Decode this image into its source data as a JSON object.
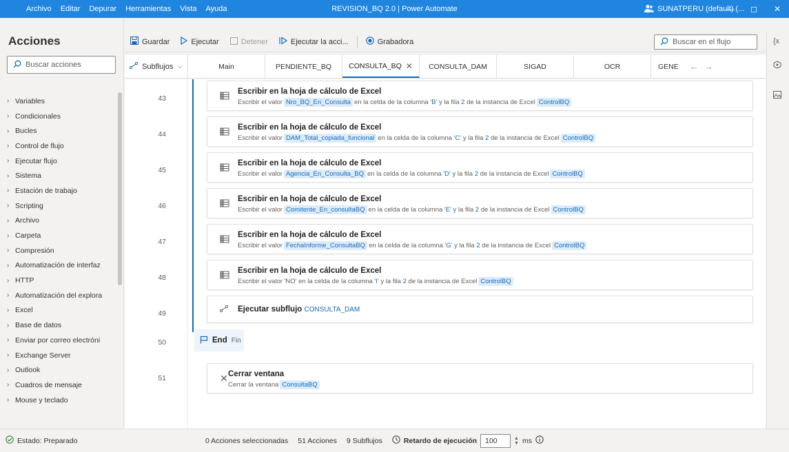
{
  "titlebar": {
    "menu": [
      "Archivo",
      "Editar",
      "Depurar",
      "Herramientas",
      "Vista",
      "Ayuda"
    ],
    "title": "REVISION_BQ 2.0 | Power Automate",
    "user": "SUNATPERU (default) (...",
    "minimize": "—",
    "maximize": "◻",
    "close": "✕",
    "color": "#1f85de"
  },
  "left_panel": {
    "title": "Acciones",
    "search_placeholder": "Buscar acciones",
    "items": [
      "Variables",
      "Condicionales",
      "Bucles",
      "Control de flujo",
      "Ejecutar flujo",
      "Sistema",
      "Estación de trabajo",
      "Scripting",
      "Archivo",
      "Carpeta",
      "Compresión",
      "Automatización de interfaz",
      "HTTP",
      "Automatización del explora",
      "Excel",
      "Base de datos",
      "Enviar por correo electróni",
      "Exchange Server",
      "Outlook",
      "Cuadros de mensaje",
      "Mouse y teclado"
    ]
  },
  "toolbar": {
    "save": "Guardar",
    "run": "Ejecutar",
    "stop": "Detener",
    "run_next": "Ejecutar la acci...",
    "recorder": "Grabadora",
    "search_placeholder": "Buscar en el flujo"
  },
  "tabs": {
    "subflows": "Subflujos",
    "items": [
      "Main",
      "PENDIENTE_BQ",
      "CONSULTA_BQ",
      "CONSULTA_DAM",
      "SIGAD",
      "OCR",
      "GENE"
    ],
    "active": "CONSULTA_BQ"
  },
  "actions": [
    {
      "line": "43",
      "title": "Escribir en la hoja de cálculo de Excel",
      "pre": "Escribir el valor",
      "var": "Nro_BQ_En_Consulta",
      "mid": "en la celda de la columna",
      "col": "'B'",
      "y_text": "y la fila",
      "row": "2",
      "post": "de la instancia de Excel",
      "inst": "ControlBQ"
    },
    {
      "line": "44",
      "title": "Escribir en la hoja de cálculo de Excel",
      "pre": "Escribir el valor",
      "var": "DAM_Total_copiada_funcional",
      "mid": "en la celda de la columna",
      "col": "'C'",
      "y_text": "y la fila",
      "row": "2",
      "post": "de la instancia de Excel",
      "inst": "ControlBQ"
    },
    {
      "line": "45",
      "title": "Escribir en la hoja de cálculo de Excel",
      "pre": "Escribir el valor",
      "var": "Agencia_En_Consulta_BQ",
      "mid": "en la celda de la columna",
      "col": "'D'",
      "y_text": "y la fila",
      "row": "2",
      "post": "de la instancia de Excel",
      "inst": "ControlBQ"
    },
    {
      "line": "46",
      "title": "Escribir en la hoja de cálculo de Excel",
      "pre": "Escribir el valor",
      "var": "Comitente_En_consultaBQ",
      "mid": "en la celda de la columna",
      "col": "'E'",
      "y_text": "y la fila",
      "row": "2",
      "post": "de la instancia de Excel",
      "inst": "ControlBQ"
    },
    {
      "line": "47",
      "title": "Escribir en la hoja de cálculo de Excel",
      "pre": "Escribir el valor",
      "var": "FechaInforme_ConsultaBQ",
      "mid": "en la celda de la columna",
      "col": "'G'",
      "y_text": "y la fila",
      "row": "2",
      "post": "de la instancia de Excel",
      "inst": "ControlBQ"
    },
    {
      "line": "48",
      "title": "Escribir en la hoja de cálculo de Excel",
      "pre": "Escribir el valor 'NO' en la celda de la columna",
      "var": "",
      "mid": "",
      "col": "'I'",
      "y_text": "y la fila",
      "row": "2",
      "post": "de la instancia de Excel",
      "inst": "ControlBQ"
    }
  ],
  "subflow_action": {
    "line": "49",
    "title": "Ejecutar subflujo",
    "target": "CONSULTA_DAM"
  },
  "end_block": {
    "line": "50",
    "label": "End",
    "sub": "Fin"
  },
  "close_action": {
    "line": "51",
    "title": "Cerrar ventana",
    "desc": "Cerrar la ventana",
    "var": "ConsultaBQ"
  },
  "statusbar": {
    "state": "Estado: Preparado",
    "selected": "0 Acciones seleccionadas",
    "actions_count": "51 Acciones",
    "subflows_count": "9 Subflujos",
    "delay_label": "Retardo de ejecución",
    "delay_value": "100",
    "unit": "ms"
  },
  "right_strip": {
    "vars": "{x"
  }
}
